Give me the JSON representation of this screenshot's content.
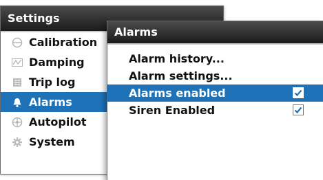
{
  "settings": {
    "title": "Settings",
    "items": [
      {
        "label": "Calibration",
        "icon": "calibration-icon"
      },
      {
        "label": "Damping",
        "icon": "damping-icon"
      },
      {
        "label": "Trip log",
        "icon": "trip-log-icon"
      },
      {
        "label": "Alarms",
        "icon": "bell-icon",
        "selected": true
      },
      {
        "label": "Autopilot",
        "icon": "autopilot-icon"
      },
      {
        "label": "System",
        "icon": "gear-icon"
      }
    ]
  },
  "alarms": {
    "title": "Alarms",
    "items": [
      {
        "label": "Alarm history..."
      },
      {
        "label": "Alarm settings..."
      },
      {
        "label": "Alarms enabled",
        "checked": true,
        "selected": true
      },
      {
        "label": "Siren Enabled",
        "checked": true
      }
    ]
  },
  "colors": {
    "selection": "#1e73b8",
    "titlebar": "#2a2a2a",
    "checkmark": "#1e73b8"
  }
}
